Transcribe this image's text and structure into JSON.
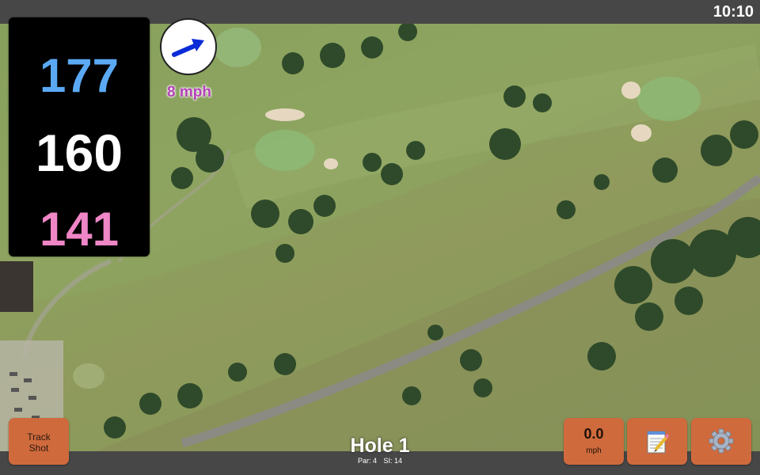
{
  "status_bar": {
    "time": "10:10"
  },
  "distances": {
    "back": "177",
    "center": "160",
    "front": "141"
  },
  "wind": {
    "speed": "8 mph",
    "arrow_icon": "arrow-right-icon"
  },
  "hole": {
    "title": "Hole 1",
    "par": "Par: 4",
    "stroke_index": "SI: 14"
  },
  "buttons": {
    "track_shot": {
      "line1": "Track",
      "line2": "Shot"
    },
    "speed": {
      "value": "0.0",
      "unit": "mph"
    },
    "notes_icon": "notepad-icon",
    "settings_icon": "gear-icon"
  },
  "colors": {
    "back_distance": "#5ba9f5",
    "center_distance": "#ffffff",
    "front_distance": "#ef86c6",
    "wind_text": "#b43fb8",
    "button": "#cf6a3d",
    "bars": "#474747"
  }
}
